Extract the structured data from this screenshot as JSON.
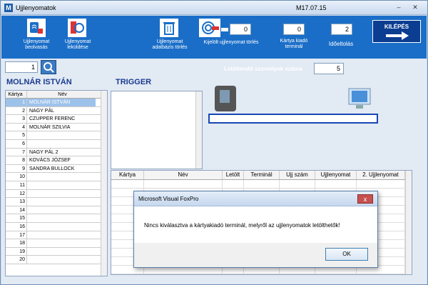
{
  "window": {
    "title": "Ujjlenyomatok",
    "version": "M17.07.15"
  },
  "toolbar": {
    "fp_read_label": "Ujjlenyomat beolvasás",
    "fp_send_label": "Ujjlenyomat leküldése",
    "fp_db_delete_label": "Ujjlenyomat adatbázis törlés",
    "fp_selected_delete_label": "Kijelölt ujjlenyomat törlés",
    "selected_value": "0",
    "card_terminal_label": "Kártya kiadó terminál",
    "card_terminal_value": "0",
    "timeout_label": "Időeltolás",
    "timeout_value": "2",
    "exit_label": "KILÉPÉS"
  },
  "search": {
    "value": "1"
  },
  "person_name": "MOLNÁR ISTVÁN",
  "trigger_label": "TRIGGER",
  "download": {
    "label": "Letöltendő személyek száma",
    "value": "5"
  },
  "list": {
    "headers": [
      "Kártya",
      "Név"
    ],
    "rows": [
      [
        "1",
        "MOLNÁR ISTVÁN"
      ],
      [
        "2",
        "NAGY PÁL"
      ],
      [
        "3",
        "CZUPPER FERENC"
      ],
      [
        "4",
        "MOLNÁR SZILVIA"
      ],
      [
        "5",
        ""
      ],
      [
        "6",
        ""
      ],
      [
        "7",
        "NAGY PÁL 2"
      ],
      [
        "8",
        "KOVÁCS JÓZSEF"
      ],
      [
        "9",
        "SANDRA BULLOCK"
      ],
      [
        "10",
        ""
      ],
      [
        "11",
        ""
      ],
      [
        "12",
        ""
      ],
      [
        "13",
        ""
      ],
      [
        "14",
        ""
      ],
      [
        "15",
        ""
      ],
      [
        "16",
        ""
      ],
      [
        "17",
        ""
      ],
      [
        "18",
        ""
      ],
      [
        "19",
        ""
      ],
      [
        "20",
        ""
      ]
    ]
  },
  "grid2": {
    "headers": [
      "Kártya",
      "Név",
      "Letölt",
      "Terminál",
      "Ujj szám",
      "Ujjlenyomat",
      "2. Ujjlenyomat"
    ]
  },
  "dialog": {
    "title": "Microsoft Visual FoxPro",
    "message": "Nincs kiválasztva a kártyakiadó terminál, melyről az ujjlenyomatok letölthetők!",
    "ok_label": "OK",
    "close_symbol": "x"
  },
  "colors": {
    "toolbar": "#1a6ec8",
    "exit_button": "#0b3d91",
    "accent_text": "#1a3b8f"
  }
}
